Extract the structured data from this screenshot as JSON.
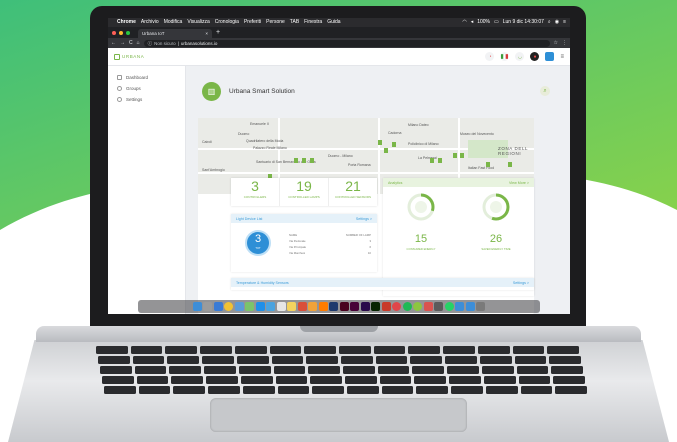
{
  "menubar": {
    "apple": "",
    "app_name": "Chrome",
    "menus": [
      "Archivio",
      "Modifica",
      "Visualizza",
      "Cronologia",
      "Preferiti",
      "Persone",
      "TAB",
      "Finestra",
      "Guida"
    ],
    "battery": "100%",
    "clock": "Lun 9 dic  14:30:07"
  },
  "browser": {
    "tab_title": "Urbana IoT",
    "tab_close": "×",
    "new_tab": "+",
    "security_label": "Non sicuro",
    "url": "urbanasolutions.io",
    "star": "☆",
    "menu": "⋮"
  },
  "app": {
    "logo_text": "URBANA",
    "sidebar": [
      {
        "label": "Dashboard",
        "icon": "dashboard-icon"
      },
      {
        "label": "Groups",
        "icon": "groups-icon"
      },
      {
        "label": "Settings",
        "icon": "settings-icon"
      }
    ],
    "page_title": "Urbana Smart Solution"
  },
  "map": {
    "labels": [
      "Emanuele II",
      "Duomo",
      "Quadrilatero della Moda",
      "Milano Dateo",
      "Cadorna",
      "Museo del Novecento",
      "Palazzo Reale Milano",
      "Cairoli",
      "Policlinico di Milano",
      "Duomo - Milano",
      "ZONA DELL REGIONI",
      "Santuario di San Bernardino alle Ossa",
      "Porta Romana",
      "La Pelmerai",
      "Italian Fast Food",
      "Sant'Ambrogio"
    ]
  },
  "stats": [
    {
      "value": "3",
      "label": "CONTROLLERS"
    },
    {
      "value": "19",
      "label": "CONTROLLED LAMPS"
    },
    {
      "value": "21",
      "label": "CONTROLLED SENSORS"
    }
  ],
  "analytics": {
    "title": "Analytics",
    "link": "View More >",
    "gauges": [
      {
        "value": "15",
        "label": "CONSUMED ENERGY",
        "fill": 0.3
      },
      {
        "value": "26",
        "label": "SAVED ENERGY TIME",
        "fill": 0.55
      }
    ]
  },
  "light_device_list": {
    "title": "Light Device List",
    "link": "Settings >",
    "count": "3",
    "count_label": "TOT",
    "col_name": "NAME",
    "col_count": "NUMBER OF LAMP",
    "rows": [
      {
        "name": "Via Pedonale",
        "count": "3"
      },
      {
        "name": "Via Principale",
        "count": "6"
      },
      {
        "name": "Via Marchesi",
        "count": "10"
      }
    ]
  },
  "temp_humidity": {
    "title": "Temperature & Humidity Sensors",
    "link": "Settings >"
  },
  "colors": {
    "brand_green": "#7ab648",
    "blue": "#2e8fd6",
    "bg_green": "#46c36e"
  }
}
